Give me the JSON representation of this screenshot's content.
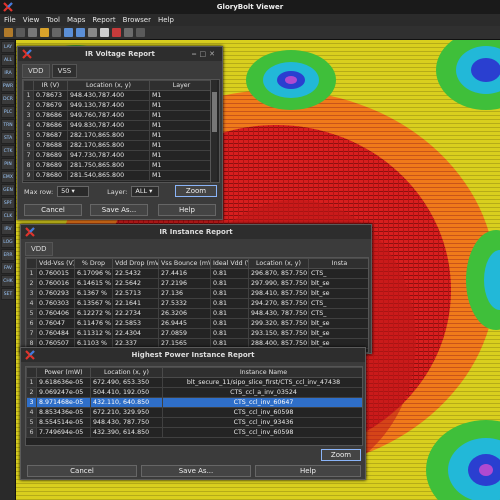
{
  "app": {
    "title": "GloryBolt Viewer",
    "menu": [
      "File",
      "View",
      "Tool",
      "Maps",
      "Report",
      "Browser",
      "Help"
    ],
    "sidebar_items": [
      "LAY",
      "ALL",
      "IRA",
      "PWR",
      "DCR",
      "PLC",
      "TRN",
      "STA",
      "CTK",
      "PIN",
      "EMX",
      "GEN",
      "SPF",
      "CLK",
      "IRV",
      "LOG",
      "ERR",
      "FAV",
      "CHK",
      "SET"
    ]
  },
  "ir_voltage": {
    "title": "IR Voltage Report",
    "tabs": [
      "VDD",
      "VSS"
    ],
    "columns": [
      "IR (V)",
      "Location (x, y)",
      "Layer"
    ],
    "rows": [
      [
        "0.78673",
        "948.430,787.400",
        "M1"
      ],
      [
        "0.78679",
        "949.130,787.400",
        "M1"
      ],
      [
        "0.78686",
        "949.760,787.400",
        "M1"
      ],
      [
        "0.78686",
        "949.830,787.400",
        "M1"
      ],
      [
        "0.78687",
        "282.170,865.800",
        "M1"
      ],
      [
        "0.78688",
        "282.170,865.800",
        "M1"
      ],
      [
        "0.78689",
        "947.730,787.400",
        "M1"
      ],
      [
        "0.78689",
        "281.750,865.800",
        "M1"
      ],
      [
        "0.78680",
        "281.540,865.800",
        "M1"
      ]
    ],
    "max_row_label": "Max row:",
    "max_row_value": "50",
    "layer_label": "Layer:",
    "layer_value": "ALL",
    "zoom": "Zoom",
    "cancel": "Cancel",
    "save_as": "Save As...",
    "help": "Help"
  },
  "ir_instance": {
    "title": "IR Instance Report",
    "tabs": [
      "VDD"
    ],
    "columns": [
      "Vdd-Vss (V)",
      "% Drop",
      "Vdd Drop (mV)",
      "Vss Bounce (mV)",
      "Ideal Vdd (V)",
      "Location (x, y)",
      "Insta"
    ],
    "rows": [
      [
        "0.760015",
        "6.17096 %",
        "22.5432",
        "27.4416",
        "0.81",
        "296.870, 857.750",
        "CTS_"
      ],
      [
        "0.760016",
        "6.14615 %",
        "22.5642",
        "27.2196",
        "0.81",
        "297.990, 857.750",
        "blt_se"
      ],
      [
        "0.760293",
        "6.1367 %",
        "22.5713",
        "27.136",
        "0.81",
        "298.410, 857.750",
        "blt_se"
      ],
      [
        "0.760303",
        "6.13567 %",
        "22.1641",
        "27.5332",
        "0.81",
        "294.270, 857.750",
        "CTS_"
      ],
      [
        "0.760406",
        "6.12272 %",
        "22.2734",
        "26.3206",
        "0.81",
        "948.430, 787.750",
        "CTS_"
      ],
      [
        "0.76047",
        "6.11476 %",
        "22.5853",
        "26.9445",
        "0.81",
        "299.320, 857.750",
        "blt_se"
      ],
      [
        "0.760484",
        "6.11312 %",
        "22.4304",
        "27.0859",
        "0.81",
        "293.150, 857.750",
        "blt_se"
      ],
      [
        "0.760507",
        "6.1103 %",
        "22.337",
        "27.1565",
        "0.81",
        "288.400, 857.750",
        "blt_se"
      ]
    ]
  },
  "highest_power": {
    "title": "Highest Power Instance Report",
    "columns": [
      "Power (mW)",
      "Location (x, y)",
      "Instance Name"
    ],
    "rows": [
      [
        "9.618636e-05",
        "672.490, 653.350",
        "blt_secure_11/sipo_slice_first/CTS_ccl_inv_47438"
      ],
      [
        "9.069247e-05",
        "504.410, 192.050",
        "CTS_ccl_a_inv_03524"
      ],
      [
        "8.971468e-05",
        "432.110, 640.850",
        "CTS_ccl_inv_60647"
      ],
      [
        "8.853436e-05",
        "672.210, 329.950",
        "CTS_ccl_inv_60598"
      ],
      [
        "8.554514e-05",
        "948.430, 787.750",
        "CTS_ccl_inv_93436"
      ],
      [
        "7.749694e-05",
        "432.390, 614.850",
        "CTS_ccl_inv_60598"
      ]
    ],
    "selected_row": 3,
    "zoom": "Zoom",
    "cancel": "Cancel",
    "save_as": "Save As...",
    "help": "Help"
  },
  "colors": {
    "heat_red": "#d81e1e",
    "heat_orange": "#f07a1a",
    "heat_yellow": "#e7d21a",
    "heat_green": "#3fbf3a",
    "heat_cyan": "#22b8d8",
    "heat_blue": "#2a3fd0",
    "selection": "#2f6fc9",
    "logo_red": "#e0332b",
    "logo_blue": "#3b7de0"
  }
}
